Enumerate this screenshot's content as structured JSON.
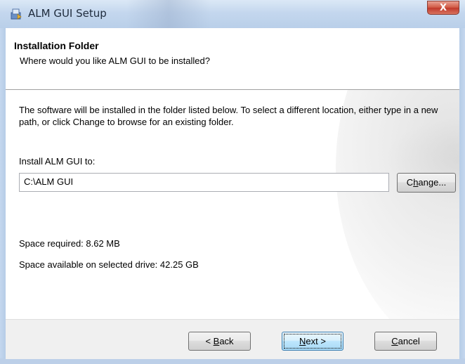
{
  "window": {
    "title": "ALM GUI Setup",
    "close_label": "X",
    "icon": "installer-icon"
  },
  "header": {
    "title": "Installation Folder",
    "subtitle": "Where would you like ALM GUI to be installed?"
  },
  "body": {
    "description": "The software will be installed in the folder listed below. To select a different location, either type in a new path, or click Change to browse for an existing folder.",
    "install_label": "Install ALM GUI to:",
    "install_path": "C:\\ALM GUI",
    "change_label_prefix": "C",
    "change_label_underlined": "h",
    "change_label_suffix": "ange...",
    "space_required": "Space required: 8.62 MB",
    "space_available": "Space available on selected drive: 42.25 GB"
  },
  "footer": {
    "back_prefix": "< ",
    "back_underlined": "B",
    "back_suffix": "ack",
    "next_underlined": "N",
    "next_suffix": "ext >",
    "cancel_underlined": "C",
    "cancel_suffix": "ancel"
  },
  "colors": {
    "titlebar": "#c4d7ee",
    "close_button": "#c0392b",
    "default_button_border": "#3c7fb1"
  }
}
